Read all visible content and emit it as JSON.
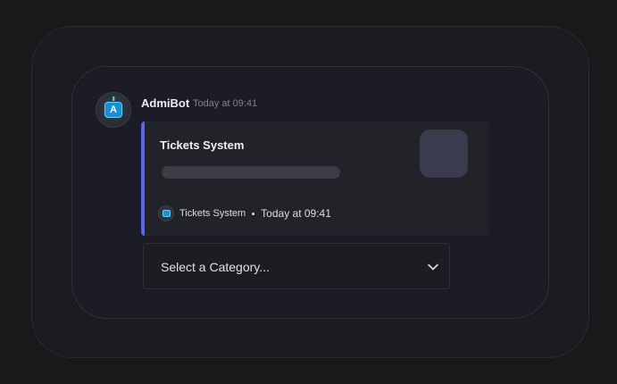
{
  "message": {
    "author": "AdmiBot",
    "timestamp": "Today at 09:41",
    "avatar_icon": "robot-icon",
    "avatar_letter": "A"
  },
  "embed": {
    "accent_color": "#5865f2",
    "title": "Tickets System",
    "footer": {
      "icon": "robot-icon",
      "name": "Tickets System",
      "time": "Today at 09:41"
    }
  },
  "select_menu": {
    "placeholder": "Select a Category...",
    "icon": "chevron-down-icon"
  }
}
